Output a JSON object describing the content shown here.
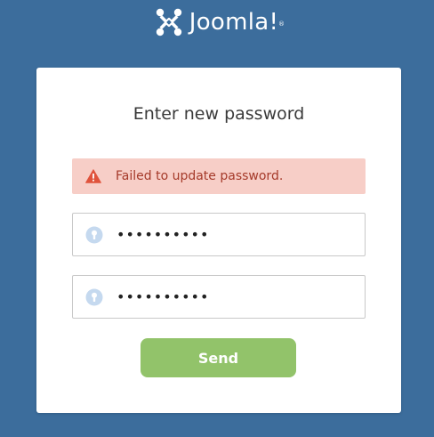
{
  "brand": {
    "name": "Joomla!",
    "registered_mark": "®",
    "logo_icon": "joomla-logo-icon"
  },
  "form": {
    "title": "Enter new password",
    "alert": {
      "icon": "warning-triangle-icon",
      "message": "Failed to update password.",
      "background_color": "#f7cec7",
      "text_color": "#a53a2a",
      "icon_color": "#e0533c"
    },
    "password_field": {
      "icon": "key-icon",
      "value": "••••••••••"
    },
    "confirm_password_field": {
      "icon": "key-icon",
      "value": "••••••••••"
    },
    "submit_label": "Send"
  },
  "colors": {
    "background": "#3c6d9c",
    "card": "#ffffff",
    "button": "#92c36a",
    "key_icon": "#c5d9ef"
  }
}
